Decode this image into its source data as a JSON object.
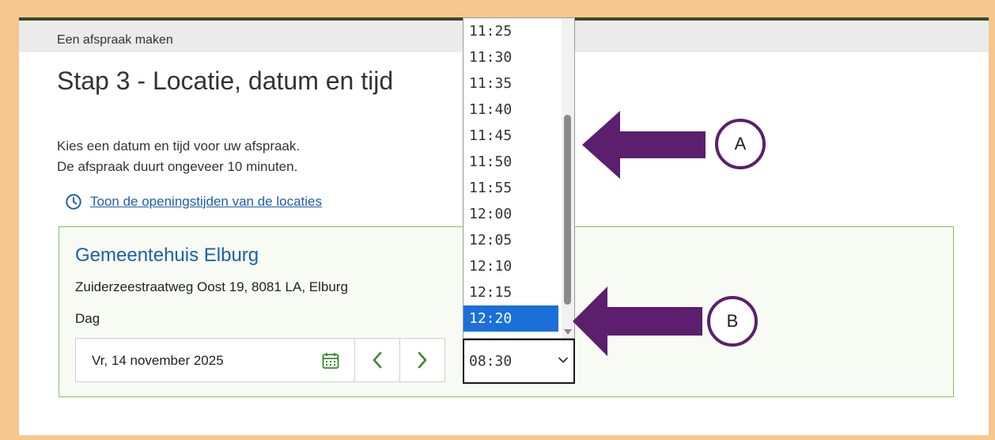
{
  "breadcrumb": "Een afspraak maken",
  "title": "Stap 3 - Locatie, datum en tijd",
  "intro": {
    "line1": "Kies een datum en tijd voor uw afspraak.",
    "line2": "De afspraak duurt ongeveer 10 minuten."
  },
  "hours_link": "Toon de openingstijden van de locaties",
  "location": {
    "name": "Gemeentehuis Elburg",
    "address": "Zuiderzeestraatweg Oost 19, 8081 LA, Elburg",
    "day_label": "Dag",
    "date_value": "Vr, 14 november 2025"
  },
  "time_select": {
    "value": "08:30",
    "options": [
      "11:25",
      "11:30",
      "11:35",
      "11:40",
      "11:45",
      "11:50",
      "11:55",
      "12:00",
      "12:05",
      "12:10",
      "12:15",
      "12:20"
    ],
    "highlighted": "12:20"
  },
  "annotations": {
    "a": "A",
    "b": "B"
  },
  "colors": {
    "frame": "#f6c78e",
    "arrow": "#5b1f6e",
    "link": "#1f5fa8",
    "selected": "#1a6fd9",
    "card_border": "#8fbf6c"
  },
  "icons": {
    "clock": "clock-icon",
    "calendar": "calendar-icon",
    "prev": "chevron-left-icon",
    "next": "chevron-right-icon",
    "dropdown": "chevron-down-icon"
  }
}
